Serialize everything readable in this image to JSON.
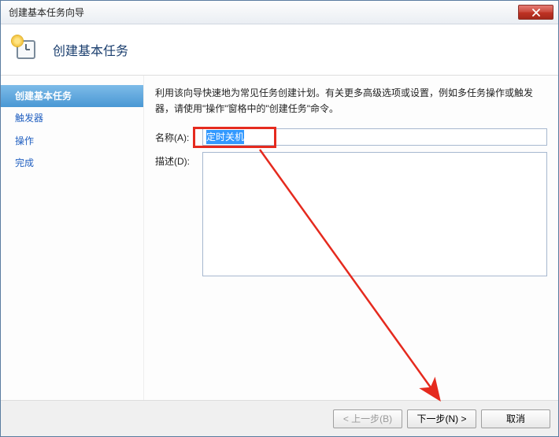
{
  "window": {
    "title": "创建基本任务向导"
  },
  "header": {
    "title": "创建基本任务"
  },
  "sidebar": {
    "items": [
      {
        "label": "创建基本任务",
        "active": true
      },
      {
        "label": "触发器",
        "active": false
      },
      {
        "label": "操作",
        "active": false
      },
      {
        "label": "完成",
        "active": false
      }
    ]
  },
  "content": {
    "instructions": "利用该向导快速地为常见任务创建计划。有关更多高级选项或设置，例如多任务操作或触发器，请使用\"操作\"窗格中的\"创建任务\"命令。",
    "name_label": "名称(A):",
    "name_value": "定时关机",
    "desc_label": "描述(D):",
    "desc_value": ""
  },
  "footer": {
    "back_label": "< 上一步(B)",
    "next_label": "下一步(N) >",
    "cancel_label": "取消"
  }
}
